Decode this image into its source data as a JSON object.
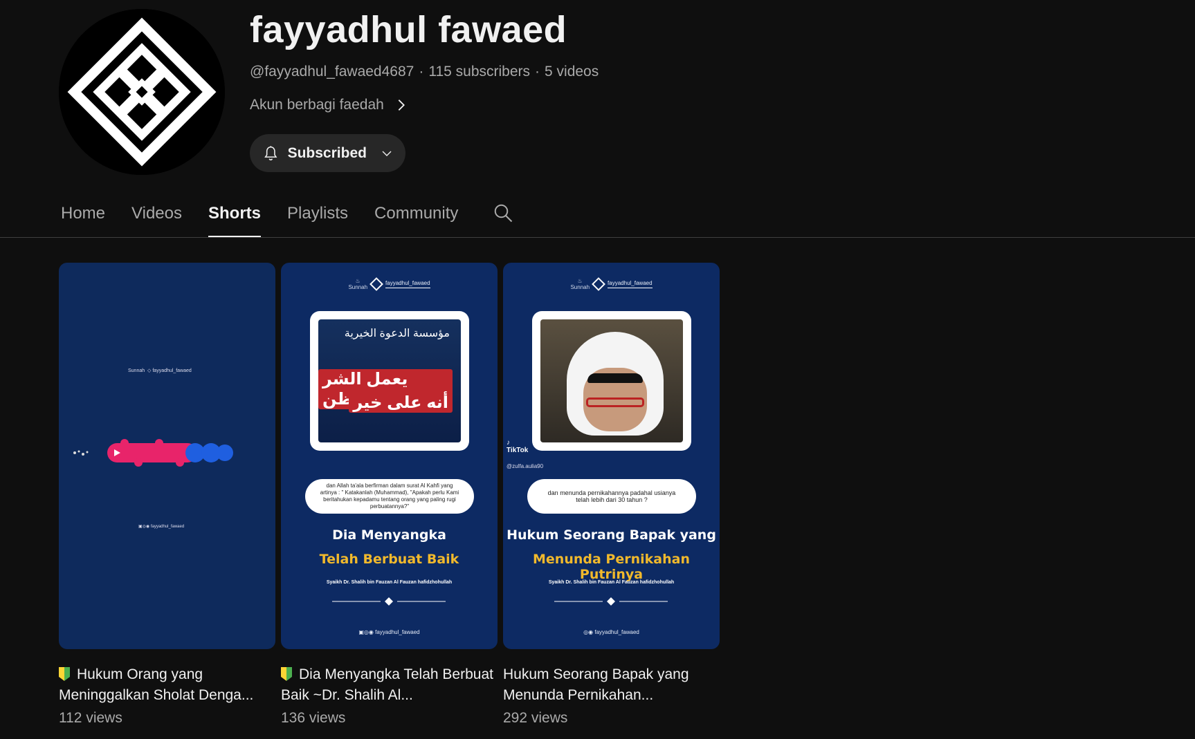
{
  "channel": {
    "name": "fayyadhul fawaed",
    "handle": "@fayyadhul_fawaed4687",
    "subscribers": "115 subscribers",
    "videos": "5 videos",
    "description": "Akun berbagi faedah",
    "avatar_icon": "diamond-knot-logo",
    "subscribe_label": "Subscribed"
  },
  "tabs": [
    {
      "label": "Home",
      "active": false
    },
    {
      "label": "Videos",
      "active": false
    },
    {
      "label": "Shorts",
      "active": true
    },
    {
      "label": "Playlists",
      "active": false
    },
    {
      "label": "Community",
      "active": false
    }
  ],
  "shorts": [
    {
      "title": "Hukum Orang yang Meninggalkan Sholat Denga...",
      "views": "112 views",
      "badge": "beginner-badge-icon",
      "thumb": {
        "handle": "fayyadhul_fawaed",
        "footer": "fayyadhul_fawaed"
      }
    },
    {
      "title": "Dia Menyangka Telah Berbuat Baik ~Dr. Shalih Al...",
      "views": "136 views",
      "badge": "beginner-badge-icon",
      "thumb": {
        "handle": "fayyadhul_fawaed",
        "arabic_logo": "مؤسسة الدعوة الخيرية",
        "arabic_line1": "يعمل الشر ويظن",
        "arabic_line2": "أنه على خير",
        "quote": "dan Allah ta'ala berfirman dalam surat Al Kahfi yang artinya : \" Katakanlah (Muhammad), \"Apakah perlu Kami beritahukan kepadamu tentang orang yang paling rugi perbuatannya?\"",
        "title_white": "Dia Menyangka",
        "title_gold": "Telah Berbuat Baik",
        "speaker": "Syaikh Dr. Shalih bin Fauzan Al Fauzan hafidzhohullah",
        "footer": "fayyadhul_fawaed"
      }
    },
    {
      "title": "Hukum Seorang Bapak yang Menunda Pernikahan...",
      "views": "292 views",
      "badge": "",
      "thumb": {
        "handle": "fayyadhul_fawaed",
        "tiktok": "TikTok",
        "tiktok_handle": "@zulfa.aulia90",
        "quote": "dan menunda pernikahannya padahal usianya telah lebih dari 30 tahun ?",
        "title_white": "Hukum Seorang Bapak yang",
        "title_gold": "Menunda Pernikahan Putrinya",
        "speaker": "Syaikh Dr. Shalih bin Fauzan Al Fauzan hafidzhohullah",
        "footer": "fayyadhul_fawaed"
      }
    }
  ],
  "colors": {
    "background": "#0f0f0f",
    "thumb_blue": "#0d2a63",
    "gold": "#f1b92c",
    "secondary_text": "#aaaaaa"
  }
}
